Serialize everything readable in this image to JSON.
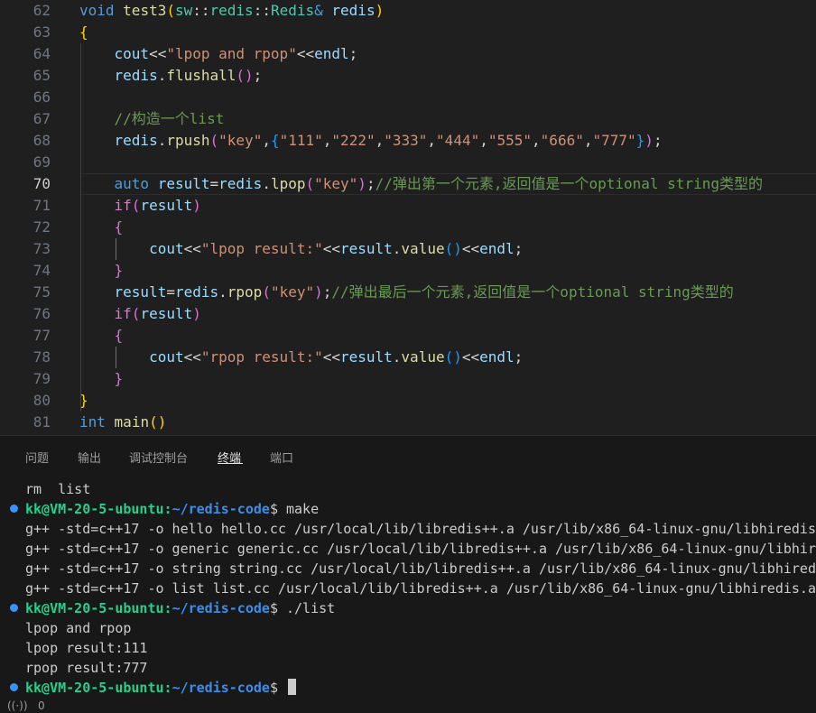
{
  "editor": {
    "line_numbers": [
      "62",
      "63",
      "64",
      "65",
      "66",
      "67",
      "68",
      "69",
      "70",
      "71",
      "72",
      "73",
      "74",
      "75",
      "76",
      "77",
      "78",
      "79",
      "80",
      "81"
    ],
    "active_line": "70",
    "lines": [
      [
        [
          "kw",
          "void"
        ],
        [
          "wt",
          " "
        ],
        [
          "fn",
          "test3"
        ],
        [
          "br1",
          "("
        ],
        [
          "ty",
          "sw"
        ],
        [
          "wt",
          "::"
        ],
        [
          "ty",
          "redis"
        ],
        [
          "wt",
          "::"
        ],
        [
          "ty",
          "Redis"
        ],
        [
          "kw",
          "&"
        ],
        [
          "wt",
          " "
        ],
        [
          "var",
          "redis"
        ],
        [
          "br1",
          ")"
        ]
      ],
      [
        [
          "br1",
          "{"
        ]
      ],
      [
        [
          "wt",
          "    "
        ],
        [
          "var",
          "cout"
        ],
        [
          "wt",
          "<<"
        ],
        [
          "str",
          "\"lpop and rpop\""
        ],
        [
          "wt",
          "<<"
        ],
        [
          "var",
          "endl"
        ],
        [
          "wt",
          ";"
        ]
      ],
      [
        [
          "wt",
          "    "
        ],
        [
          "var",
          "redis"
        ],
        [
          "wt",
          "."
        ],
        [
          "fn",
          "flushall"
        ],
        [
          "br2",
          "()"
        ],
        [
          "wt",
          ";"
        ]
      ],
      [],
      [
        [
          "wt",
          "    "
        ],
        [
          "cm",
          "//构造一个list"
        ]
      ],
      [
        [
          "wt",
          "    "
        ],
        [
          "var",
          "redis"
        ],
        [
          "wt",
          "."
        ],
        [
          "fn",
          "rpush"
        ],
        [
          "br2",
          "("
        ],
        [
          "str",
          "\"key\""
        ],
        [
          "wt",
          ","
        ],
        [
          "br3",
          "{"
        ],
        [
          "str",
          "\"111\""
        ],
        [
          "wt",
          ","
        ],
        [
          "str",
          "\"222\""
        ],
        [
          "wt",
          ","
        ],
        [
          "str",
          "\"333\""
        ],
        [
          "wt",
          ","
        ],
        [
          "str",
          "\"444\""
        ],
        [
          "wt",
          ","
        ],
        [
          "str",
          "\"555\""
        ],
        [
          "wt",
          ","
        ],
        [
          "str",
          "\"666\""
        ],
        [
          "wt",
          ","
        ],
        [
          "str",
          "\"777\""
        ],
        [
          "br3",
          "}"
        ],
        [
          "br2",
          ")"
        ],
        [
          "wt",
          ";"
        ]
      ],
      [],
      [
        [
          "wt",
          "    "
        ],
        [
          "kw",
          "auto"
        ],
        [
          "wt",
          " "
        ],
        [
          "var",
          "result"
        ],
        [
          "wt",
          "="
        ],
        [
          "var",
          "redis"
        ],
        [
          "wt",
          "."
        ],
        [
          "fn",
          "lpop"
        ],
        [
          "br2",
          "("
        ],
        [
          "str",
          "\"key\""
        ],
        [
          "br2",
          ")"
        ],
        [
          "wt",
          ";"
        ],
        [
          "cm",
          "//弹出第一个元素,返回值是一个optional string类型的"
        ]
      ],
      [
        [
          "wt",
          "    "
        ],
        [
          "ctl",
          "if"
        ],
        [
          "br2",
          "("
        ],
        [
          "var",
          "result"
        ],
        [
          "br2",
          ")"
        ]
      ],
      [
        [
          "wt",
          "    "
        ],
        [
          "br2",
          "{"
        ]
      ],
      [
        [
          "wt",
          "        "
        ],
        [
          "var",
          "cout"
        ],
        [
          "wt",
          "<<"
        ],
        [
          "str",
          "\"lpop result:\""
        ],
        [
          "wt",
          "<<"
        ],
        [
          "var",
          "result"
        ],
        [
          "wt",
          "."
        ],
        [
          "fn",
          "value"
        ],
        [
          "br3",
          "()"
        ],
        [
          "wt",
          "<<"
        ],
        [
          "var",
          "endl"
        ],
        [
          "wt",
          ";"
        ]
      ],
      [
        [
          "wt",
          "    "
        ],
        [
          "br2",
          "}"
        ]
      ],
      [
        [
          "wt",
          "    "
        ],
        [
          "var",
          "result"
        ],
        [
          "wt",
          "="
        ],
        [
          "var",
          "redis"
        ],
        [
          "wt",
          "."
        ],
        [
          "fn",
          "rpop"
        ],
        [
          "br2",
          "("
        ],
        [
          "str",
          "\"key\""
        ],
        [
          "br2",
          ")"
        ],
        [
          "wt",
          ";"
        ],
        [
          "cm",
          "//弹出最后一个元素,返回值是一个optional string类型的"
        ]
      ],
      [
        [
          "wt",
          "    "
        ],
        [
          "ctl",
          "if"
        ],
        [
          "br2",
          "("
        ],
        [
          "var",
          "result"
        ],
        [
          "br2",
          ")"
        ]
      ],
      [
        [
          "wt",
          "    "
        ],
        [
          "br2",
          "{"
        ]
      ],
      [
        [
          "wt",
          "        "
        ],
        [
          "var",
          "cout"
        ],
        [
          "wt",
          "<<"
        ],
        [
          "str",
          "\"rpop result:\""
        ],
        [
          "wt",
          "<<"
        ],
        [
          "var",
          "result"
        ],
        [
          "wt",
          "."
        ],
        [
          "fn",
          "value"
        ],
        [
          "br3",
          "()"
        ],
        [
          "wt",
          "<<"
        ],
        [
          "var",
          "endl"
        ],
        [
          "wt",
          ";"
        ]
      ],
      [
        [
          "wt",
          "    "
        ],
        [
          "br2",
          "}"
        ]
      ],
      [
        [
          "br1",
          "}"
        ]
      ],
      [
        [
          "kw",
          "int"
        ],
        [
          "wt",
          " "
        ],
        [
          "fn",
          "main"
        ],
        [
          "br1",
          "()"
        ]
      ]
    ]
  },
  "panel": {
    "tabs": [
      "问题",
      "输出",
      "调试控制台",
      "终端",
      "端口"
    ],
    "active_tab": "终端"
  },
  "terminal": {
    "lines": [
      {
        "type": "text",
        "text": "rm  list"
      },
      {
        "type": "prompt",
        "user": "kk@VM-20-5-ubuntu",
        "path": "~/redis-code",
        "sym": "$ ",
        "cmd": "make"
      },
      {
        "type": "text",
        "text": "g++ -std=c++17 -o hello hello.cc /usr/local/lib/libredis++.a /usr/lib/x86_64-linux-gnu/libhiredis"
      },
      {
        "type": "text",
        "text": "g++ -std=c++17 -o generic generic.cc /usr/local/lib/libredis++.a /usr/lib/x86_64-linux-gnu/libhire"
      },
      {
        "type": "text",
        "text": "g++ -std=c++17 -o string string.cc /usr/local/lib/libredis++.a /usr/lib/x86_64-linux-gnu/libhiredi"
      },
      {
        "type": "text",
        "text": "g++ -std=c++17 -o list list.cc /usr/local/lib/libredis++.a /usr/lib/x86_64-linux-gnu/libhiredis.a"
      },
      {
        "type": "prompt",
        "user": "kk@VM-20-5-ubuntu",
        "path": "~/redis-code",
        "sym": "$ ",
        "cmd": "./list"
      },
      {
        "type": "text",
        "text": "lpop and rpop"
      },
      {
        "type": "text",
        "text": "lpop result:111"
      },
      {
        "type": "text",
        "text": "rpop result:777"
      },
      {
        "type": "prompt",
        "user": "kk@VM-20-5-ubuntu",
        "path": "~/redis-code",
        "sym": "$ ",
        "cmd": "",
        "cursor": true
      }
    ]
  },
  "status": {
    "icon": "broadcast-icon",
    "count": "0"
  },
  "colors": {
    "accent": "#3794ff",
    "user_green": "#23d18b",
    "path_blue": "#3b8eea"
  }
}
